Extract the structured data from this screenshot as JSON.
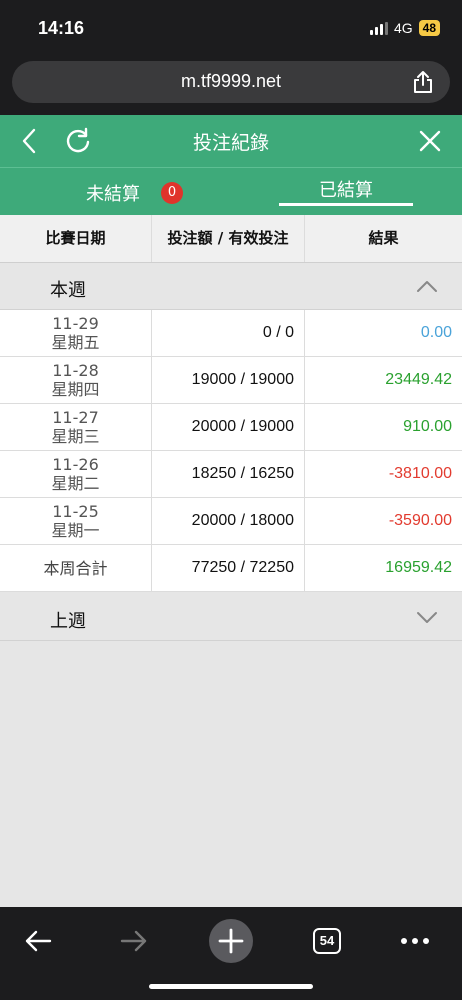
{
  "status_bar": {
    "time": "14:16",
    "network": "4G",
    "battery": "48"
  },
  "browser": {
    "url": "m.tf9999.net",
    "tab_count": "54"
  },
  "header": {
    "title": "投注紀錄"
  },
  "tabs": [
    {
      "label": "未結算",
      "badge": "0"
    },
    {
      "label": "已結算"
    }
  ],
  "columns": [
    "比賽日期",
    "投注額 / 有效投注",
    "結果"
  ],
  "this_week": {
    "label": "本週",
    "rows": [
      {
        "date": "11-29",
        "weekday": "星期五",
        "amount": "0 / 0",
        "result": "0.00",
        "result_color": "#4aa3d9"
      },
      {
        "date": "11-28",
        "weekday": "星期四",
        "amount": "19000 / 19000",
        "result": "23449.42",
        "result_color": "#2aa12f"
      },
      {
        "date": "11-27",
        "weekday": "星期三",
        "amount": "20000 / 19000",
        "result": "910.00",
        "result_color": "#2aa12f"
      },
      {
        "date": "11-26",
        "weekday": "星期二",
        "amount": "18250 / 16250",
        "result": "-3810.00",
        "result_color": "#e23b2f"
      },
      {
        "date": "11-25",
        "weekday": "星期一",
        "amount": "20000 / 18000",
        "result": "-3590.00",
        "result_color": "#e23b2f"
      }
    ],
    "total": {
      "label": "本周合計",
      "amount": "77250 / 72250",
      "result": "16959.42",
      "result_color": "#2aa12f"
    }
  },
  "last_week": {
    "label": "上週"
  },
  "colors": {
    "brand_green": "#3eaa7a",
    "badge_red": "#e0342b"
  }
}
